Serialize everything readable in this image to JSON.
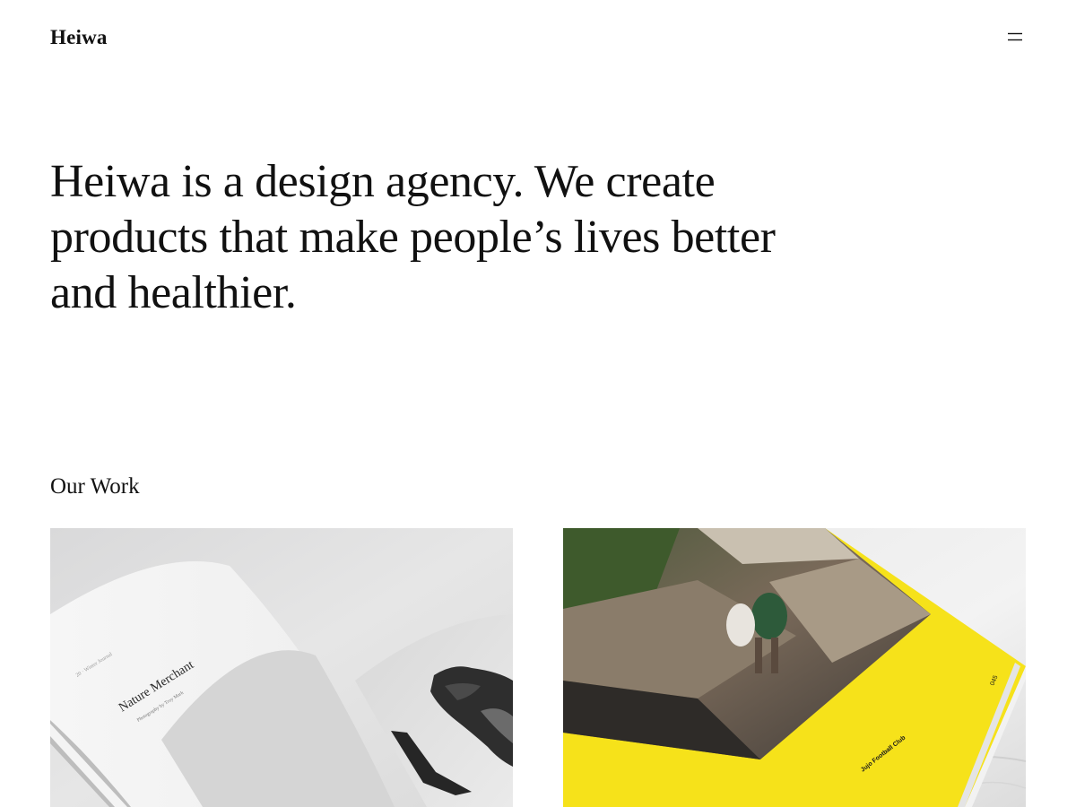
{
  "header": {
    "brand": "Heiwa",
    "menu_icon": "hamburger-menu-icon"
  },
  "hero": {
    "text": "Heiwa is a design agency. We create products that make people’s lives better and healthier."
  },
  "work": {
    "title": "Our Work",
    "items": [
      {
        "page_title": "Nature Merchant",
        "page_subtitle": "Photography by Troy Mark",
        "page_kicker": "20 · Winter Journal",
        "accent": "#e8e8e8"
      },
      {
        "page_caption": "Jujo Football Club",
        "page_number": "045",
        "accent": "#f6e21a"
      }
    ]
  }
}
